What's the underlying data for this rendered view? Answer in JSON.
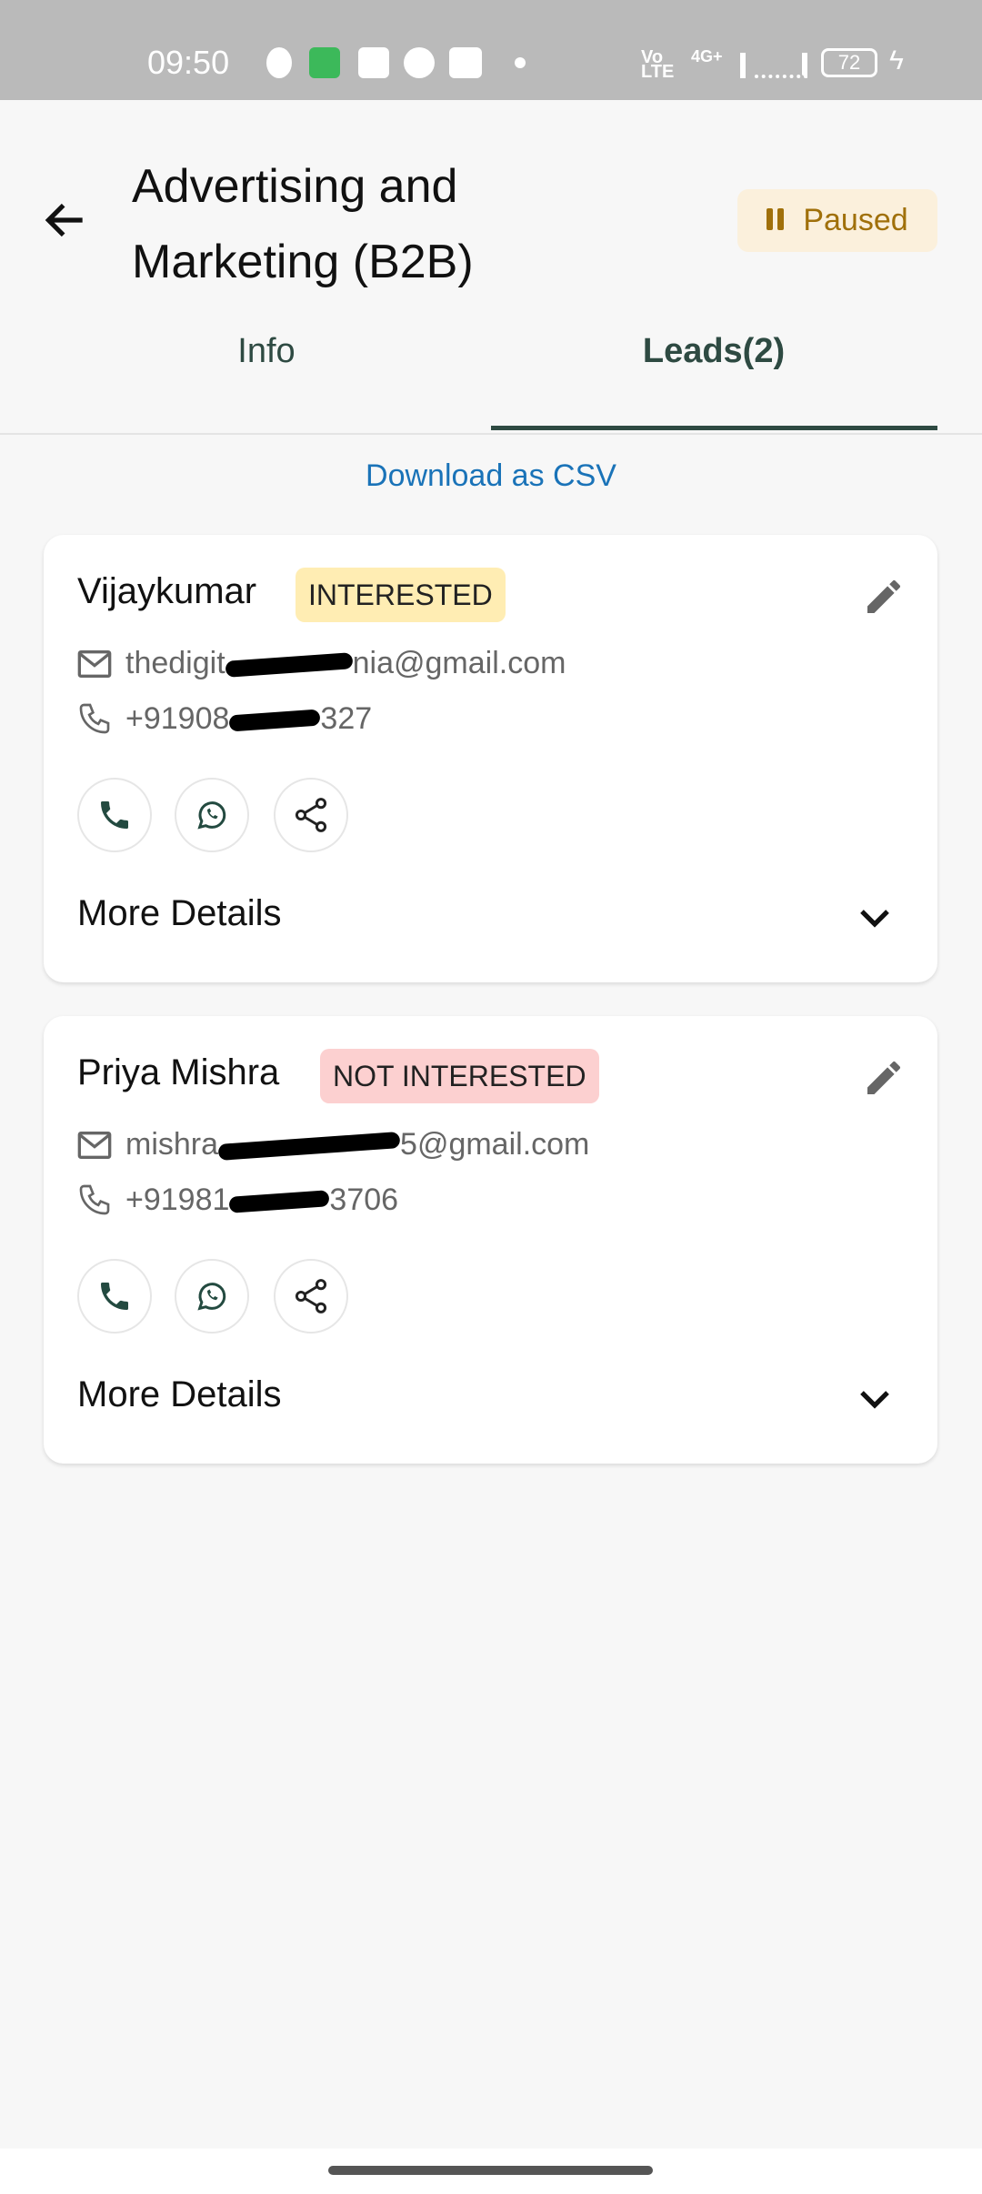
{
  "status_bar": {
    "time": "09:50",
    "battery": "72",
    "network": "4G+"
  },
  "header": {
    "title_line1": "Advertising and",
    "title_line2": "Marketing (B2B)",
    "status_badge": "Paused",
    "status_color": "#a0700a"
  },
  "tabs": [
    {
      "label": "Info",
      "active": false
    },
    {
      "label": "Leads(2)",
      "active": true
    }
  ],
  "download_label": "Download as CSV",
  "leads": [
    {
      "name": "Vijaykumar",
      "status": "INTERESTED",
      "status_bg": "#ffedb3",
      "email_prefix": "thedigit",
      "email_suffix": "nia@gmail.com",
      "phone_prefix": "+91908",
      "phone_suffix": "327",
      "more": "More Details"
    },
    {
      "name": "Priya Mishra",
      "status": "NOT INTERESTED",
      "status_bg": "#fcd0d0",
      "email_prefix": "mishra",
      "email_suffix": "5@gmail.com",
      "phone_prefix": "+91981",
      "phone_suffix": "3706",
      "more": "More Details"
    }
  ],
  "icons": [
    "back-arrow",
    "pause",
    "edit-pencil",
    "mail",
    "phone",
    "whatsapp",
    "share",
    "chevron-down"
  ]
}
